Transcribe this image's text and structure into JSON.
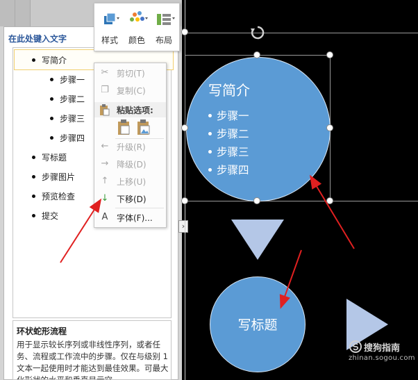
{
  "text_pane": {
    "title": "在此处键入文字",
    "items": [
      {
        "level": 1,
        "text": "写简介"
      },
      {
        "level": 2,
        "text": "步骤一"
      },
      {
        "level": 2,
        "text": "步骤二"
      },
      {
        "level": 2,
        "text": "步骤三"
      },
      {
        "level": 2,
        "text": "步骤四"
      },
      {
        "level": 1,
        "text": "写标题"
      },
      {
        "level": 1,
        "text": "步骤图片"
      },
      {
        "level": 1,
        "text": "预览检查"
      },
      {
        "level": 1,
        "text": "提交"
      }
    ],
    "description": {
      "title": "环状蛇形流程",
      "body": "用于显示较长序列或非线性序列，或者任务、流程或工作流中的步骤。仅在与级别 1 文本一起使用时才能达到最佳效果。可最大化形状的水平和垂直显示空"
    }
  },
  "mini_toolbar": {
    "style_label": "样式",
    "color_label": "颜色",
    "layout_label": "布局"
  },
  "context_menu": {
    "cut": "剪切(T)",
    "copy": "复制(C)",
    "paste_options": "粘贴选项:",
    "promote": "升级(R)",
    "demote": "降级(D)",
    "move_up": "上移(U)",
    "move_down": "下移(D)",
    "font": "字体(F)..."
  },
  "canvas": {
    "circle1": {
      "title": "写简介",
      "items": [
        "步骤一",
        "步骤二",
        "步骤三",
        "步骤四"
      ]
    },
    "circle2": {
      "title": "写标题"
    }
  },
  "watermark": {
    "name": "搜狗指南",
    "url": "zhinan.sogou.com"
  },
  "colors": {
    "shape_fill": "#5b9bd5",
    "arrow_shape": "#b4c7e7",
    "annotation_arrow": "#e02020",
    "pane_title": "#2b579a"
  }
}
